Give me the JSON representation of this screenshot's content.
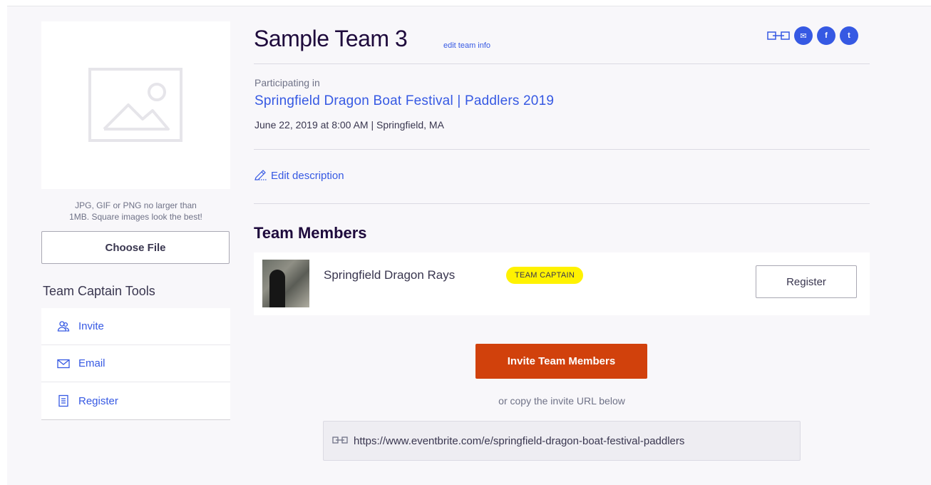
{
  "upload": {
    "hint_line1": "JPG, GIF or PNG no larger than",
    "hint_line2": "1MB. Square images look the best!",
    "choose_file_label": "Choose File"
  },
  "tools": {
    "title": "Team Captain Tools",
    "items": [
      {
        "label": "Invite",
        "icon": "users-icon"
      },
      {
        "label": "Email",
        "icon": "envelope-icon"
      },
      {
        "label": "Register",
        "icon": "clipboard-icon"
      }
    ]
  },
  "team": {
    "name": "Sample Team 3",
    "edit_link": "edit team info"
  },
  "event": {
    "participating_label": "Participating in",
    "name": "Springfield Dragon Boat Festival | Paddlers 2019",
    "date_location": "June 22, 2019 at 8:00 AM | Springfield, MA"
  },
  "description": {
    "edit_label": "Edit description"
  },
  "members": {
    "title": "Team Members",
    "rows": [
      {
        "name": "Springfield Dragon Rays",
        "badge": "TEAM CAPTAIN",
        "action": "Register"
      }
    ]
  },
  "invite": {
    "button_label": "Invite Team Members",
    "copy_hint": "or copy the invite URL below",
    "url": "https://www.eventbrite.com/e/springfield-dragon-boat-festival-paddlers"
  },
  "share": {
    "email_glyph": "✉",
    "facebook_glyph": "f",
    "twitter_glyph": "t"
  },
  "colors": {
    "link": "#3659e3",
    "primary_button": "#d1410c",
    "badge": "#fff200"
  }
}
